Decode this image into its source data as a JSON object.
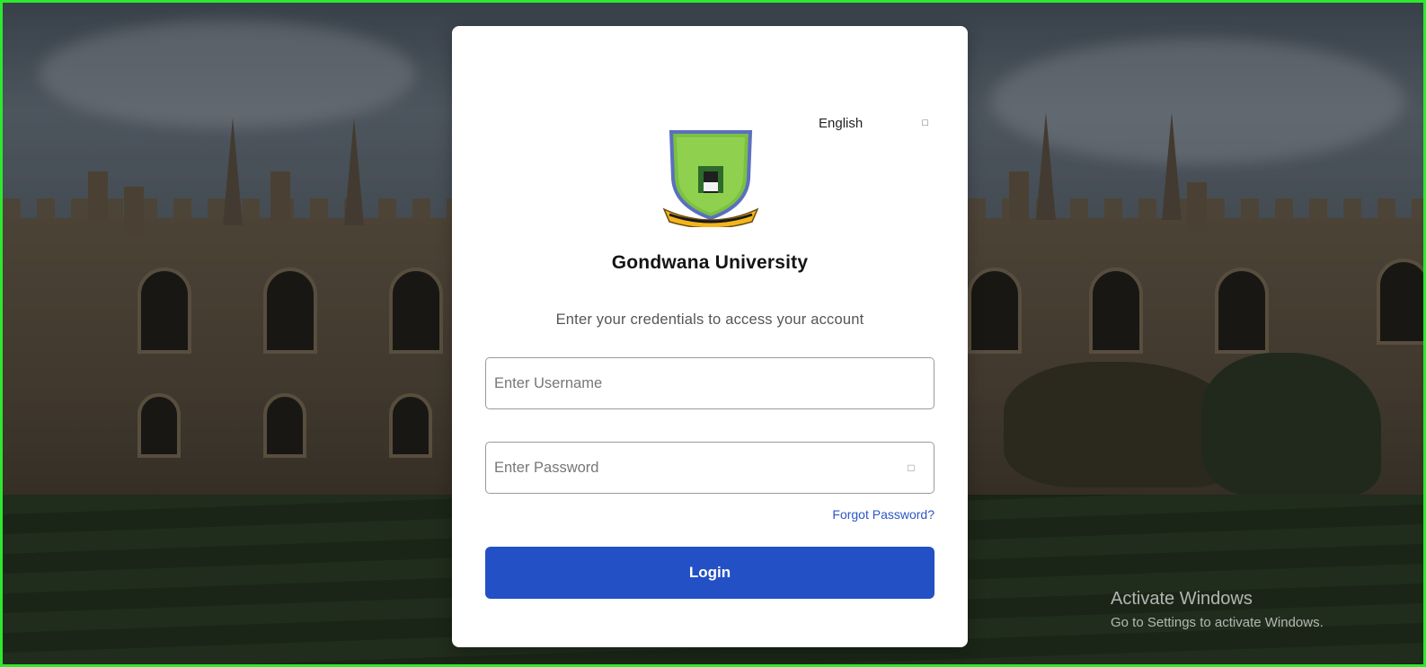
{
  "language": {
    "selected": "English",
    "icon": "chevron-down-icon"
  },
  "university": {
    "name": "Gondwana University"
  },
  "login": {
    "subtitle": "Enter your credentials to access your account",
    "username_placeholder": "Enter Username",
    "password_placeholder": "Enter Password",
    "forgot_label": "Forgot Password?",
    "login_label": "Login"
  },
  "watermark": {
    "title": "Activate Windows",
    "subtitle": "Go to Settings to activate Windows."
  },
  "colors": {
    "primary": "#2450c5",
    "link": "#2b56c8",
    "frame": "#2ee82e",
    "crest_green": "#7ac142"
  }
}
